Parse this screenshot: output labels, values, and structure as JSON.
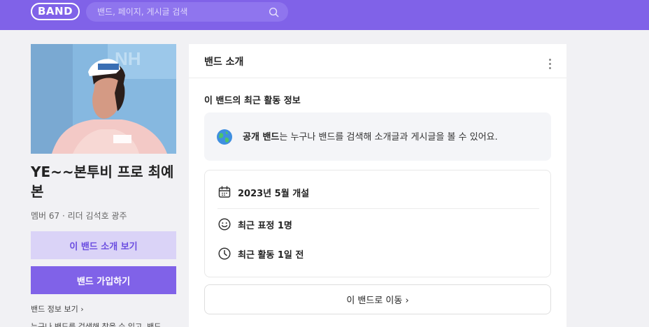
{
  "header": {
    "logo": "BAND",
    "search_placeholder": "밴드, 페이지, 게시글 검색"
  },
  "sidebar": {
    "band_name": "YE~~본투비 프로 최예본",
    "meta": "멤버 67 · 리더 김석호 광주",
    "intro_button": "이 밴드 소개 보기",
    "join_button": "밴드 가입하기",
    "info_link": "밴드 정보 보기",
    "description": "누구나 밴드를 검색해 찾을 수 있고, 밴드"
  },
  "panel": {
    "title": "밴드 소개",
    "activity_title": "이 밴드의 최근 활동 정보",
    "public_label": "공개 밴드",
    "public_desc": "는 누구나 밴드를 검색해 소개글과 게시글을 볼 수 있어요.",
    "stats": [
      {
        "icon": "calendar-icon",
        "text": "2023년 5월 개설"
      },
      {
        "icon": "smile-icon",
        "text": "최근 표정 1명"
      },
      {
        "icon": "clock-icon",
        "text": "최근 활동 1일 전"
      }
    ],
    "goto_button": "이 밴드로 이동"
  },
  "colors": {
    "brand": "#8062e8",
    "brand_light": "#dad3f7"
  }
}
